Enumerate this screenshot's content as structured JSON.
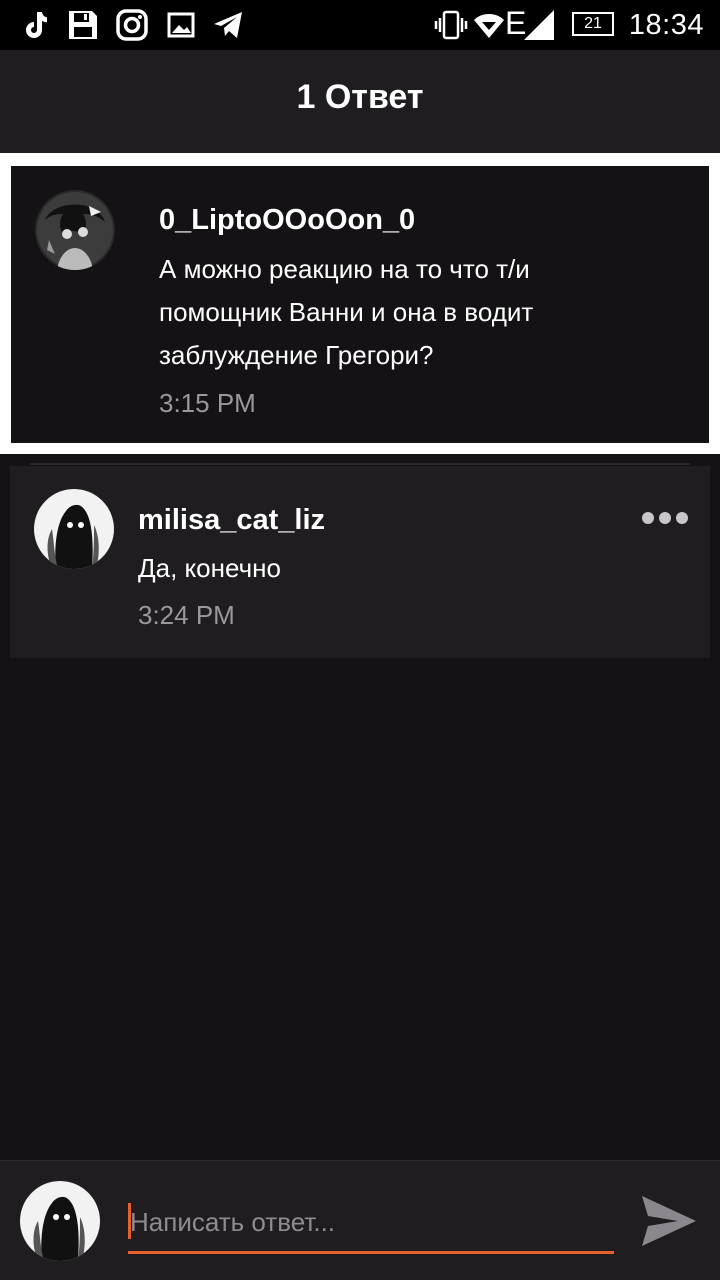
{
  "status_bar": {
    "time": "18:34",
    "battery_level": "21",
    "network_type": "E",
    "left_icons": [
      "tiktok-icon",
      "save-icon",
      "instagram-icon",
      "gallery-icon",
      "telegram-icon"
    ],
    "right_icons": [
      "vibrate-icon",
      "wifi-icon",
      "signal-icon",
      "battery-icon"
    ]
  },
  "header": {
    "title": "1 Ответ"
  },
  "parent_comment": {
    "author": "0_LiptoOOoOon_0",
    "text": "А можно реакцию на то что т/и помощник Ванни и она в водит заблуждение Грегори?",
    "time": "3:15 PM",
    "highlighted": true
  },
  "reply": {
    "author": "milisa_cat_liz",
    "text": "Да, конечно",
    "time": "3:24 PM"
  },
  "composer": {
    "placeholder": "Написать ответ...",
    "value": ""
  },
  "colors": {
    "background": "#141214",
    "surface": "#1f1d20",
    "accent": "#e8612c",
    "secondary_text": "#9a989c"
  }
}
